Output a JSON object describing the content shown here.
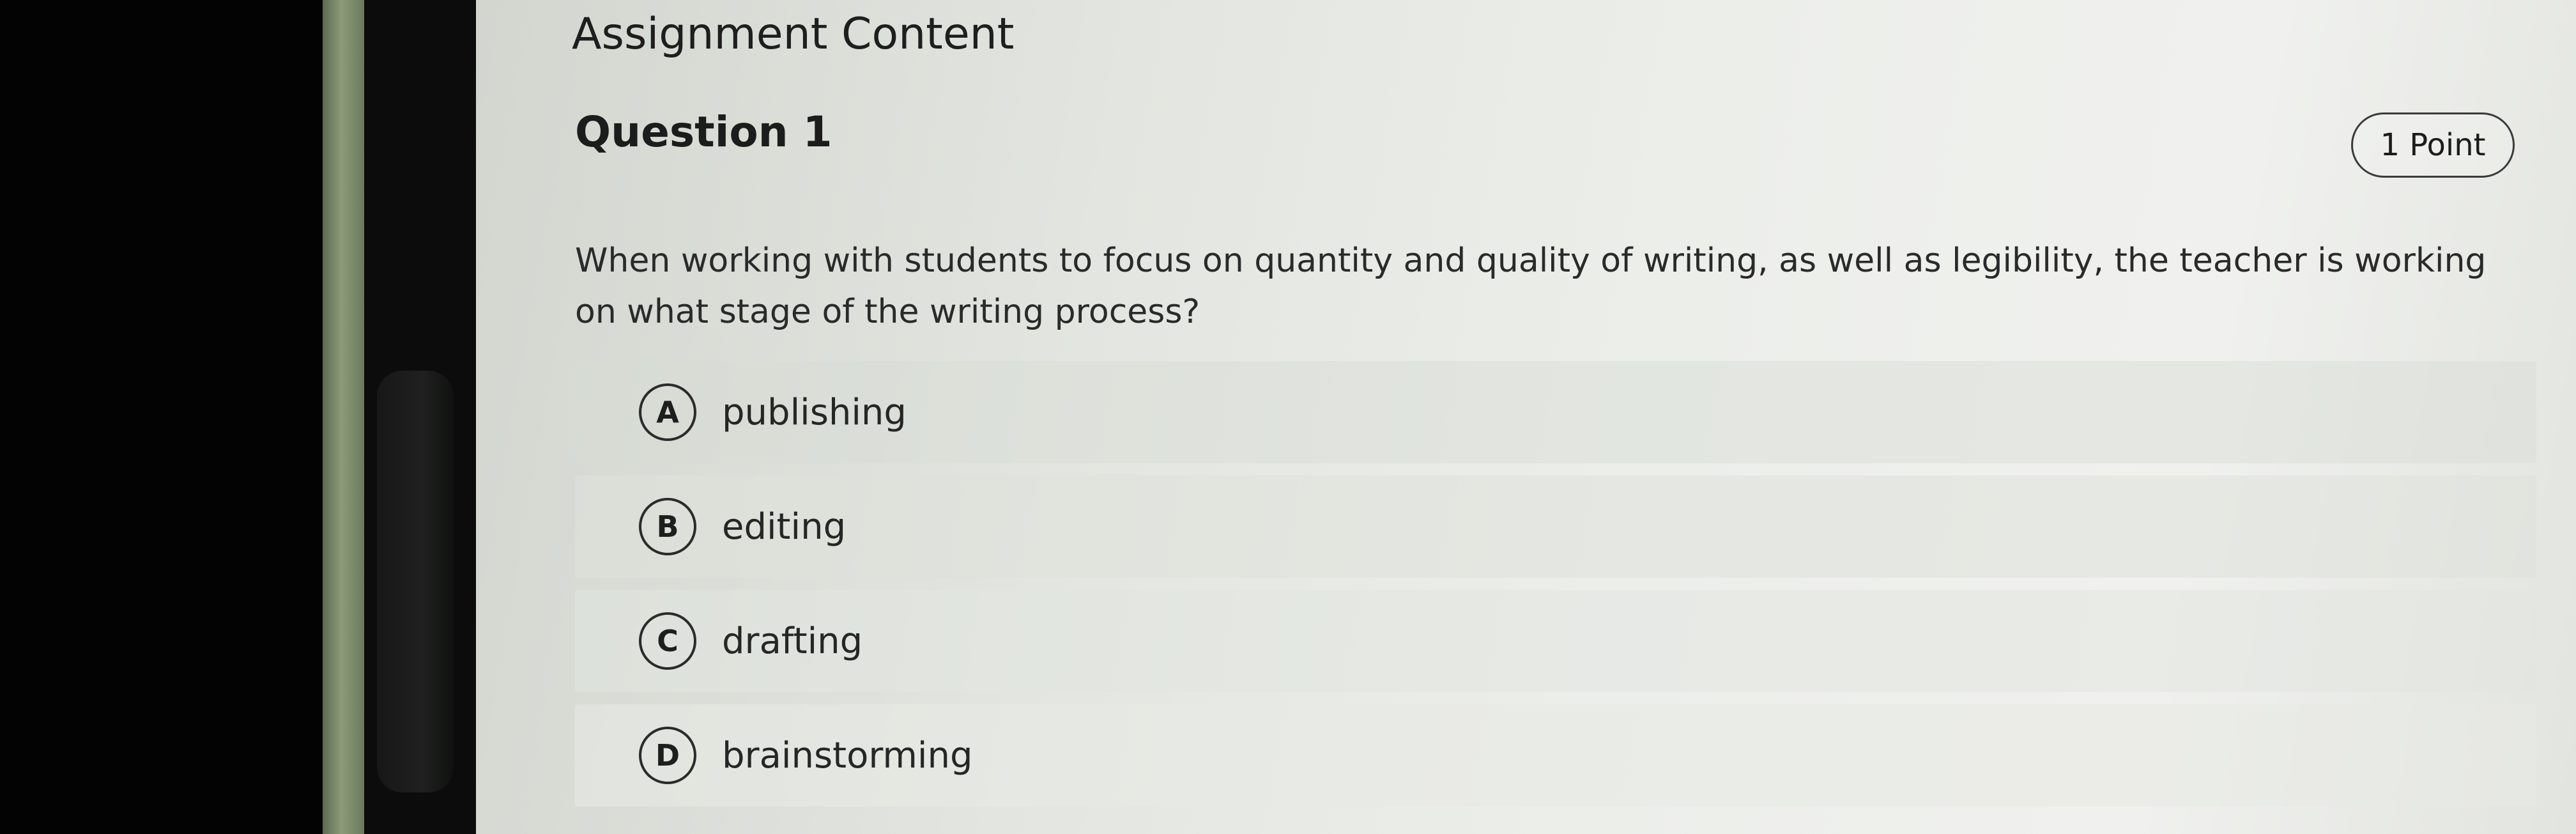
{
  "page": {
    "heading": "Assignment Content"
  },
  "question": {
    "title": "Question 1",
    "points": "1 Point",
    "text": "When working with students to focus on quantity and quality of writing, as well as legibility, the teacher is working on what stage of the writing process?",
    "options": [
      {
        "letter": "A",
        "label": "publishing"
      },
      {
        "letter": "B",
        "label": "editing"
      },
      {
        "letter": "C",
        "label": "drafting"
      },
      {
        "letter": "D",
        "label": "brainstorming"
      }
    ]
  },
  "colors": {
    "screen_background": "#e6e9e3",
    "text": "#1e1e1e",
    "bezel": "#030303"
  }
}
